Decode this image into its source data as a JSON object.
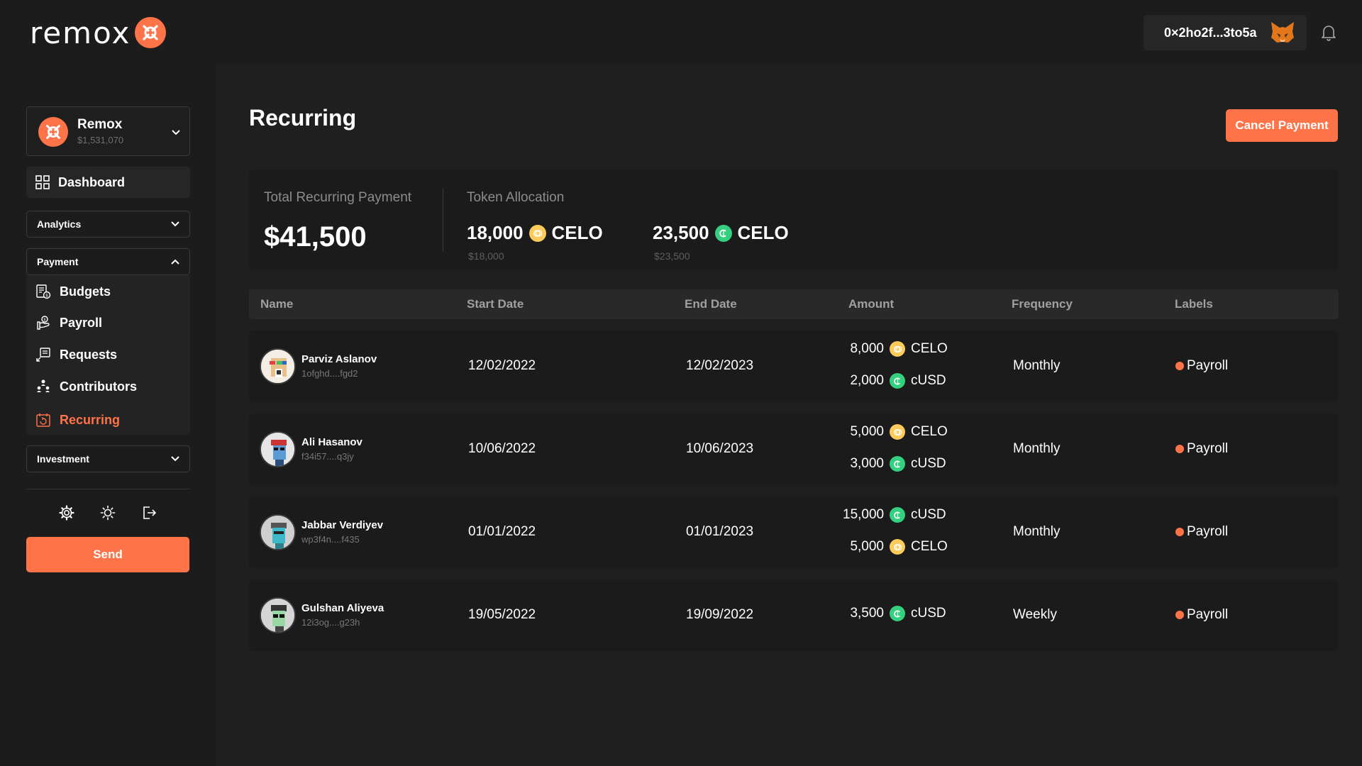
{
  "app": {
    "logo_text": "remox"
  },
  "wallet": {
    "address": "0×2ho2f...3to5a"
  },
  "sidebar": {
    "account": {
      "name": "Remox",
      "balance": "$1,531,070"
    },
    "dashboard_label": "Dashboard",
    "analytics_label": "Analytics",
    "payment_label": "Payment",
    "payment_items": [
      {
        "label": "Budgets",
        "icon": "budgets-icon"
      },
      {
        "label": "Payroll",
        "icon": "payroll-icon"
      },
      {
        "label": "Requests",
        "icon": "requests-icon"
      },
      {
        "label": "Contributors",
        "icon": "contributors-icon"
      },
      {
        "label": "Recurring",
        "icon": "recurring-icon",
        "active": true
      }
    ],
    "investment_label": "Investment",
    "send_label": "Send"
  },
  "page": {
    "title": "Recurring",
    "cancel_label": "Cancel Payment"
  },
  "summary": {
    "total_label": "Total Recurring Payment",
    "total_value": "$41,500",
    "alloc_label": "Token Allocation",
    "allocations": [
      {
        "amount": "18,000",
        "symbol": "CELO",
        "usd": "$18,000",
        "coin": "celo"
      },
      {
        "amount": "23,500",
        "symbol": "CELO",
        "usd": "$23,500",
        "coin": "cusd"
      }
    ]
  },
  "table": {
    "headers": {
      "name": "Name",
      "start": "Start Date",
      "end": "End Date",
      "amount": "Amount",
      "frequency": "Frequency",
      "labels": "Labels"
    },
    "rows": [
      {
        "name": "Parviz Aslanov",
        "address": "1ofghd....fgd2",
        "start": "12/02/2022",
        "end": "12/02/2023",
        "amounts": [
          {
            "value": "8,000",
            "symbol": "CELO",
            "coin": "celo"
          },
          {
            "value": "2,000",
            "symbol": "cUSD",
            "coin": "cusd"
          }
        ],
        "frequency": "Monthly",
        "label": "Payroll"
      },
      {
        "name": "Ali Hasanov",
        "address": "f34i57....q3jy",
        "start": "10/06/2022",
        "end": "10/06/2023",
        "amounts": [
          {
            "value": "5,000",
            "symbol": "CELO",
            "coin": "celo"
          },
          {
            "value": "3,000",
            "symbol": "cUSD",
            "coin": "cusd"
          }
        ],
        "frequency": "Monthly",
        "label": "Payroll"
      },
      {
        "name": "Jabbar Verdiyev",
        "address": "wp3f4n....f435",
        "start": "01/01/2022",
        "end": "01/01/2023",
        "amounts": [
          {
            "value": "15,000",
            "symbol": "cUSD",
            "coin": "cusd"
          },
          {
            "value": "5,000",
            "symbol": "CELO",
            "coin": "celo"
          }
        ],
        "frequency": "Monthly",
        "label": "Payroll"
      },
      {
        "name": "Gulshan Aliyeva",
        "address": "12i3og....g23h",
        "start": "19/05/2022",
        "end": "19/09/2022",
        "amounts": [
          {
            "value": "3,500",
            "symbol": "cUSD",
            "coin": "cusd"
          }
        ],
        "frequency": "Weekly",
        "label": "Payroll"
      }
    ]
  },
  "colors": {
    "accent": "#ff7348",
    "celo": "#fbcc5c",
    "cusd": "#35d07f"
  }
}
